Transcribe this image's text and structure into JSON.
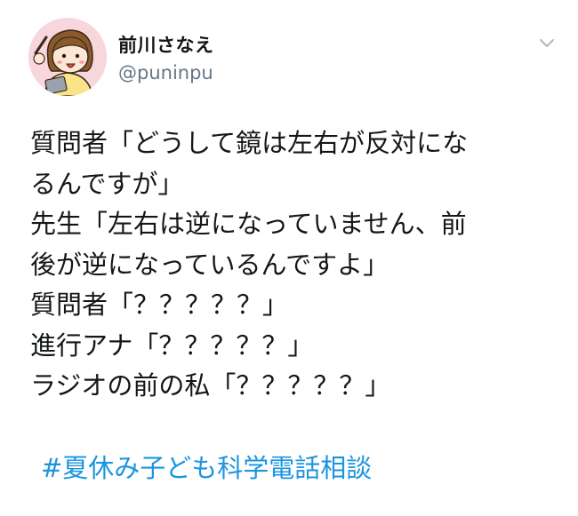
{
  "user": {
    "display_name": "前川さなえ",
    "handle": "@puninpu"
  },
  "icons": {
    "caret": "chevron-down-icon",
    "avatar": "avatar-illustration"
  },
  "tweet": {
    "lines": [
      "質問者「どうして鏡は左右が反対にな",
      "るんですが」",
      "先生「左右は逆になっていません、前",
      "後が逆になっているんですよ」",
      "質問者「？？？？？」",
      "進行アナ「？？？？？」",
      "ラジオの前の私「？？？？？」"
    ],
    "hashtag": "#夏休み子ども科学電話相談"
  },
  "colors": {
    "text": "#14171a",
    "secondary": "#657786",
    "link": "#1b95e0"
  }
}
